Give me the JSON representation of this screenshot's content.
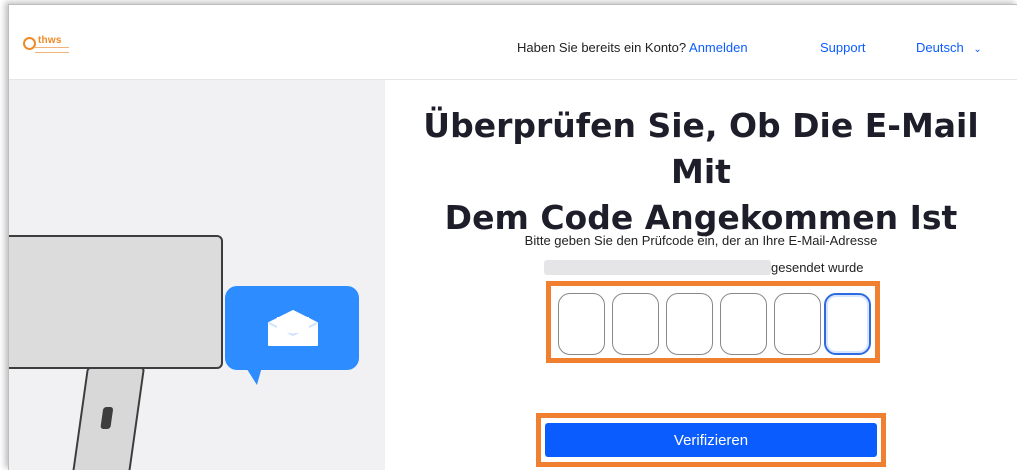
{
  "header": {
    "logo_text": "thws",
    "account_question": "Haben Sie bereits ein Konto?",
    "login_link": "Anmelden",
    "support_link": "Support",
    "language": "Deutsch"
  },
  "main": {
    "title_line1": "Überprüfen Sie, Ob Die E-Mail Mit",
    "title_line2": "Dem Code Angekommen Ist",
    "description_line1": "Bitte geben Sie den Prüfcode ein, der an Ihre E-Mail-Adresse",
    "description_line2_suffix": "gesendet wurde",
    "code_digits": [
      "",
      "",
      "",
      "",
      "",
      ""
    ],
    "verify_button": "Verifizieren"
  },
  "colors": {
    "accent_blue": "#0b5cff",
    "highlight_orange": "#f07f2f",
    "bubble_blue": "#2d8cff",
    "logo_orange": "#f08a24"
  },
  "icons": [
    "chevron-down-icon",
    "envelope-icon",
    "monitor-illustration",
    "chat-bubble-illustration"
  ]
}
